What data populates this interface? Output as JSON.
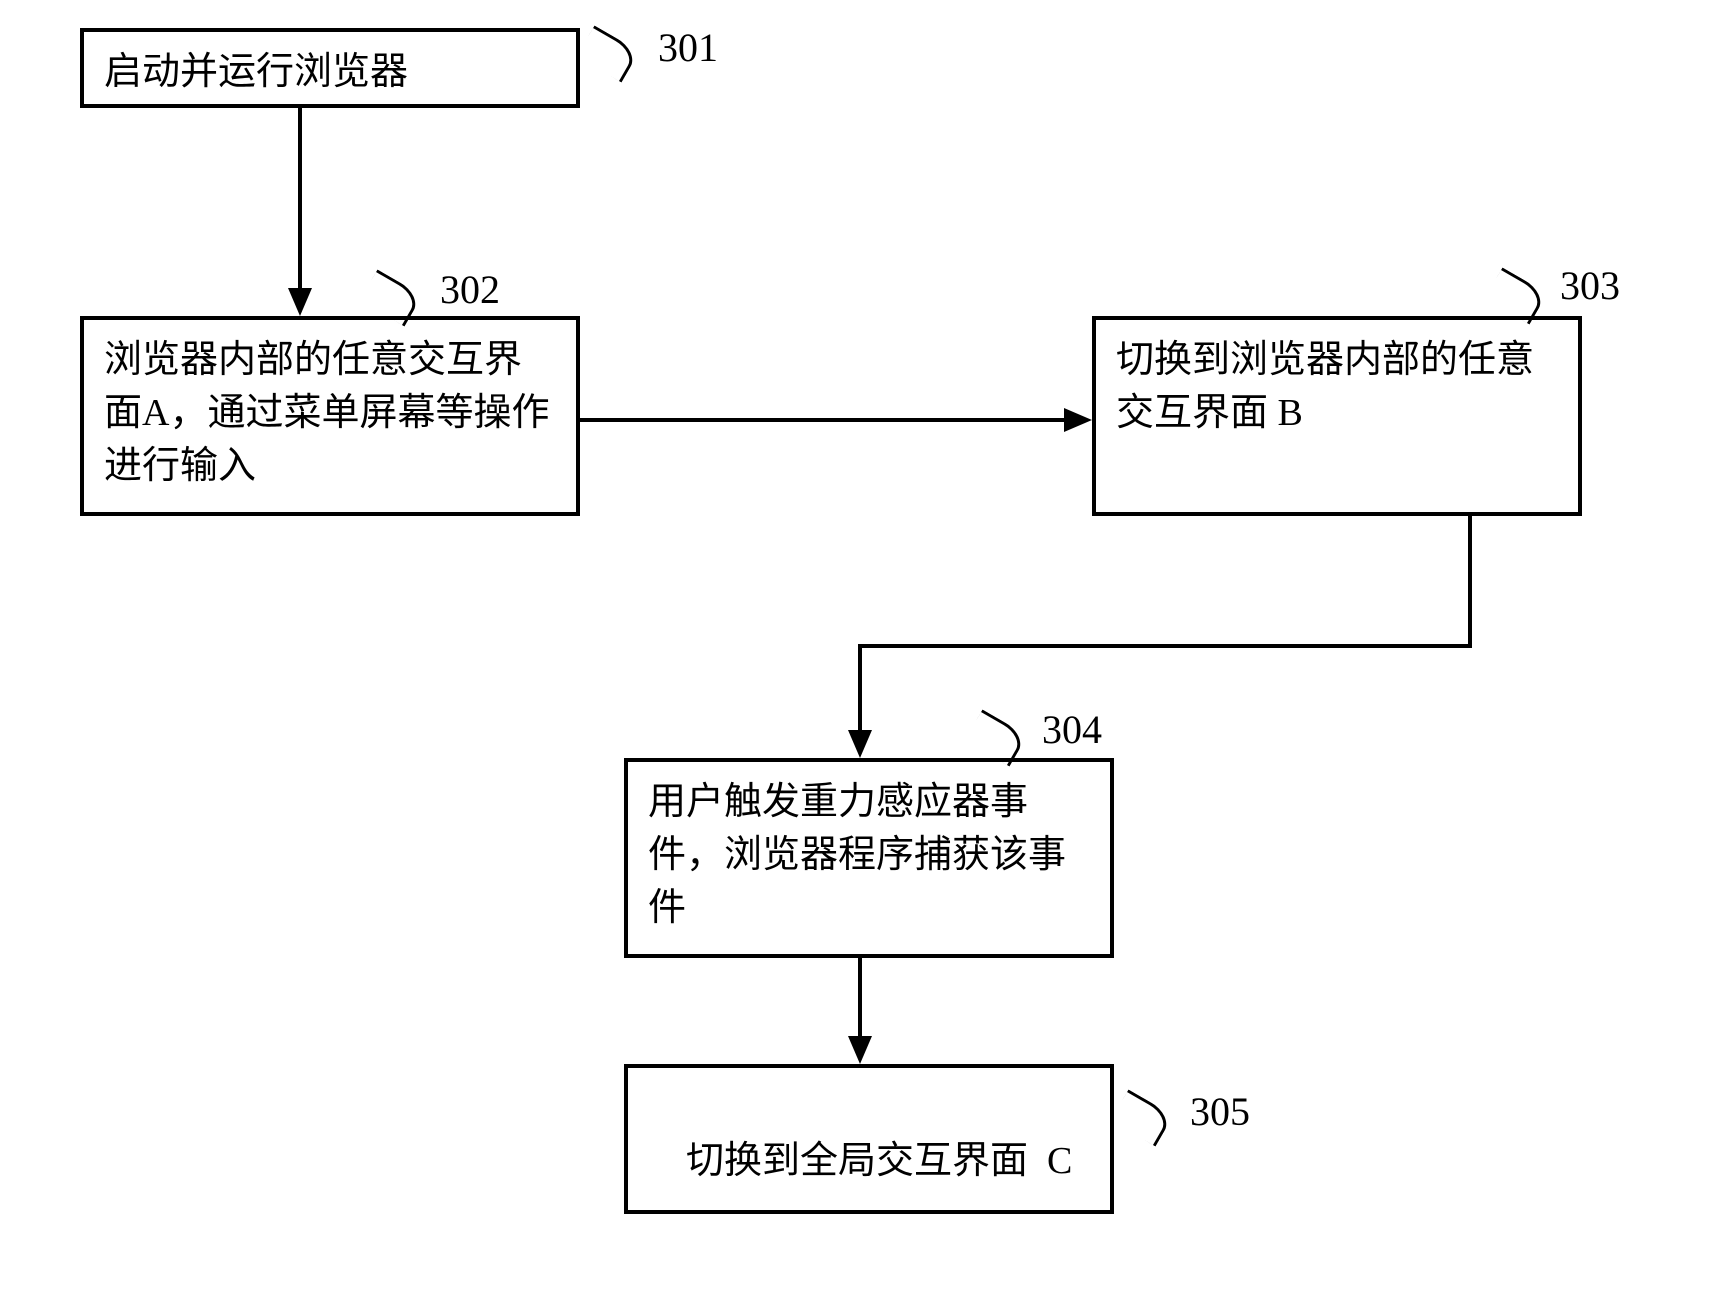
{
  "steps": {
    "s301": {
      "num": "301",
      "text": "启动并运行浏览器"
    },
    "s302": {
      "num": "302",
      "text": "浏览器内部的任意交互界面A，通过菜单屏幕等操作进行输入"
    },
    "s303": {
      "num": "303",
      "text": "切换到浏览器内部的任意交互界面  B"
    },
    "s304": {
      "num": "304",
      "text": "用户触发重力感应器事件，浏览器程序捕获该事件"
    },
    "s305": {
      "num": "305",
      "text": "  切换到全局交互界面  C"
    }
  }
}
